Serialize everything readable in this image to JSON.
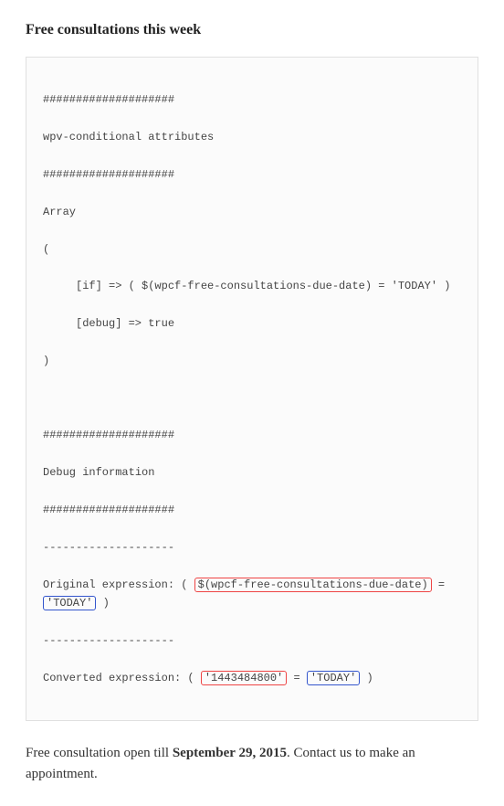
{
  "heading": "Free consultations this week",
  "code": {
    "hashes1": "####################",
    "label_attrs": "wpv-conditional attributes",
    "hashes2": "####################",
    "array": "Array",
    "paren_open": "(",
    "if_line": "[if] => ( $(wpcf-free-consultations-due-date) = 'TODAY' )",
    "debug_line": "[debug] => true",
    "paren_close": ")",
    "hashes3": "####################",
    "label_debug": "Debug information",
    "hashes4": "####################",
    "dashes1": "--------------------",
    "orig_prefix": "Original expression: ( ",
    "orig_field": "$(wpcf-free-consultations-due-date)",
    "orig_eq": " = ",
    "orig_today": "'TODAY'",
    "orig_suffix": " )",
    "dashes2": "--------------------",
    "conv_prefix": "Converted expression: ( ",
    "conv_value": "'1443484800'",
    "conv_eq": " = ",
    "conv_today": "'TODAY'",
    "conv_suffix": " )"
  },
  "footer": {
    "before": "Free consultation open till ",
    "date": "September 29, 2015",
    "after": ". Contact us to make an appointment."
  }
}
